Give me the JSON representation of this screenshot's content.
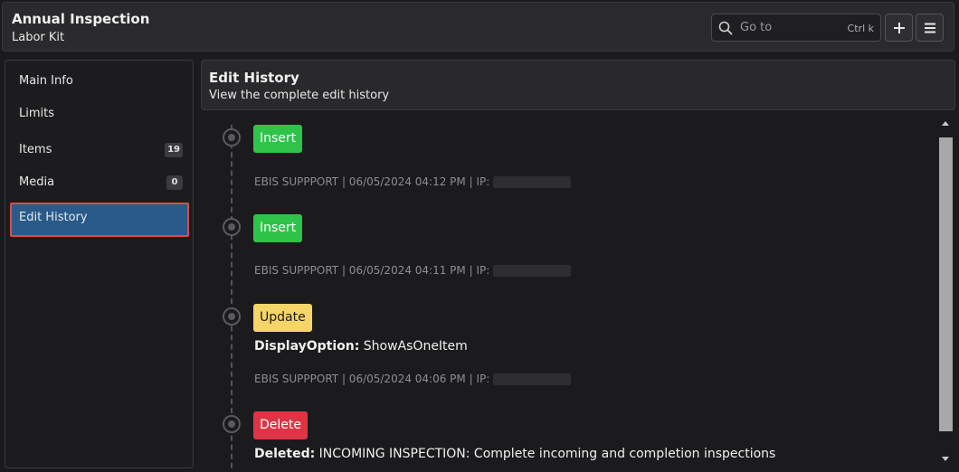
{
  "header": {
    "title": "Annual Inspection",
    "subtitle": "Labor Kit",
    "goto_placeholder": "Go to",
    "goto_shortcut": "Ctrl k",
    "search_icon": "search-icon",
    "add_icon": "plus-icon",
    "menu_icon": "hamburger-menu-icon"
  },
  "sidebar": {
    "items": [
      {
        "label": "Main Info"
      },
      {
        "label": "Limits"
      },
      {
        "label": "Items",
        "badge": "19"
      },
      {
        "label": "Media",
        "badge": "0"
      },
      {
        "label": "Edit History",
        "active": true
      }
    ]
  },
  "panel": {
    "title": "Edit History",
    "subtitle": "View the complete edit history"
  },
  "history": [
    {
      "action": "Insert",
      "meta": "EBIS SUPPPORT | 06/05/2024 04:12 PM | IP:"
    },
    {
      "action": "Insert",
      "meta": "EBIS SUPPPORT | 06/05/2024 04:11 PM | IP:"
    },
    {
      "action": "Update",
      "detail_key": "DisplayOption:",
      "detail_value": " ShowAsOneItem",
      "meta": "EBIS SUPPPORT | 06/05/2024 04:06 PM | IP:"
    },
    {
      "action": "Delete",
      "detail_key": "Deleted:",
      "detail_value": " INCOMING INSPECTION: Complete incoming and completion inspections"
    }
  ],
  "colors": {
    "insert": "#2ec44a",
    "update": "#f5d567",
    "delete": "#dd3545",
    "active_nav": "#2a5a8a",
    "highlight_border": "#e04a4a"
  }
}
